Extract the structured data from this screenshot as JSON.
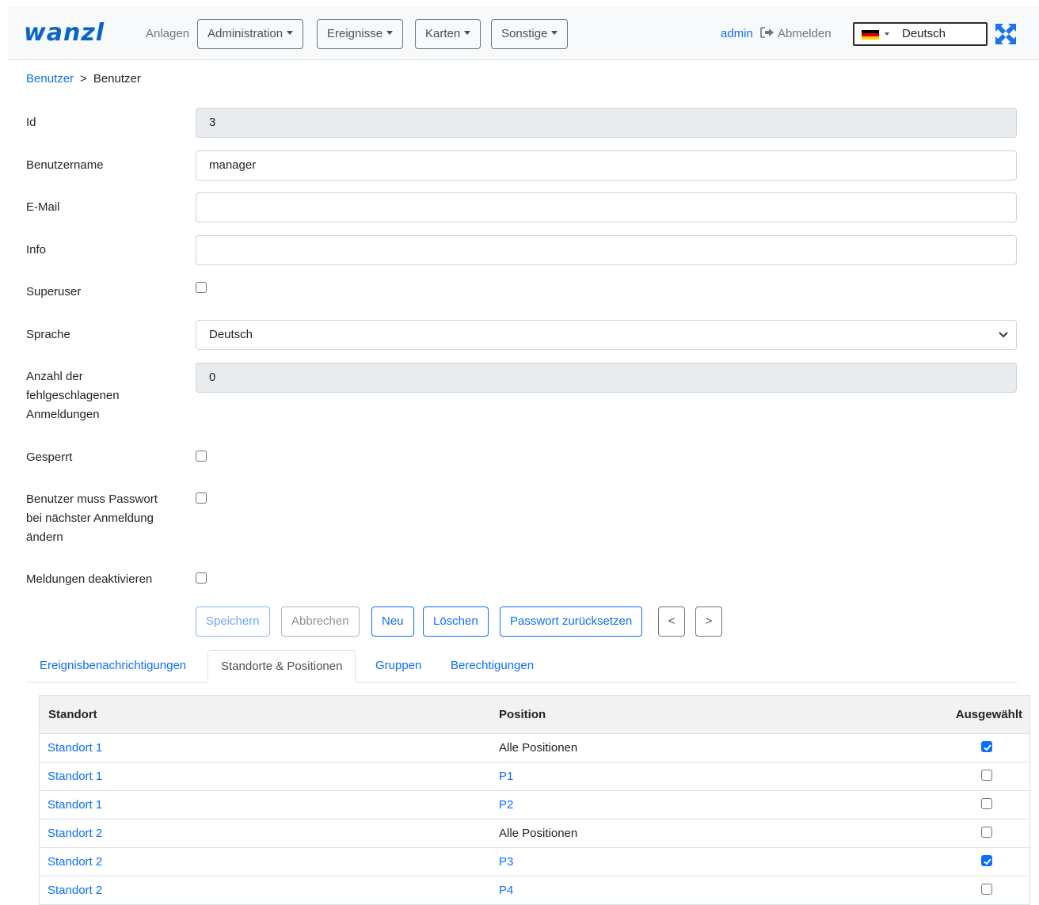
{
  "nav": {
    "logo": "wanzl",
    "plants": "Anlagen",
    "menus": [
      {
        "label": "Administration"
      },
      {
        "label": "Ereignisse"
      },
      {
        "label": "Karten"
      },
      {
        "label": "Sonstige"
      }
    ],
    "user": "admin",
    "logout": "Abmelden",
    "language": "Deutsch"
  },
  "breadcrumb": {
    "parent": "Benutzer",
    "separator": ">",
    "current": "Benutzer"
  },
  "form": {
    "id": {
      "label": "Id",
      "value": "3"
    },
    "username": {
      "label": "Benutzername",
      "value": "manager"
    },
    "email": {
      "label": "E-Mail",
      "value": ""
    },
    "info": {
      "label": "Info",
      "value": ""
    },
    "superuser": {
      "label": "Superuser",
      "checked": false
    },
    "language": {
      "label": "Sprache",
      "value": "Deutsch"
    },
    "failed_logins": {
      "label": "Anzahl der fehlgeschlagenen Anmeldungen",
      "value": "0"
    },
    "locked": {
      "label": "Gesperrt",
      "checked": false
    },
    "must_change_password": {
      "label": "Benutzer muss Passwort bei nächster Anmeldung ändern",
      "checked": false
    },
    "disable_messages": {
      "label": "Meldungen deaktivieren",
      "checked": false
    }
  },
  "actions": {
    "save": "Speichern",
    "cancel": "Abbrechen",
    "new": "Neu",
    "delete": "Löschen",
    "reset_password": "Passwort zurücksetzen",
    "prev": "<",
    "next": ">"
  },
  "tabs": [
    {
      "label": "Ereignisbenachrichtigungen",
      "active": false
    },
    {
      "label": "Standorte & Positionen",
      "active": true
    },
    {
      "label": "Gruppen",
      "active": false
    },
    {
      "label": "Berechtigungen",
      "active": false
    }
  ],
  "table": {
    "headers": [
      "Standort",
      "Position",
      "Ausgewählt"
    ],
    "rows": [
      {
        "location": "Standort 1",
        "position": "Alle Positionen",
        "position_link": false,
        "selected": true
      },
      {
        "location": "Standort 1",
        "position": "P1",
        "position_link": true,
        "selected": false
      },
      {
        "location": "Standort 1",
        "position": "P2",
        "position_link": true,
        "selected": false
      },
      {
        "location": "Standort 2",
        "position": "Alle Positionen",
        "position_link": false,
        "selected": false
      },
      {
        "location": "Standort 2",
        "position": "P3",
        "position_link": true,
        "selected": true
      },
      {
        "location": "Standort 2",
        "position": "P4",
        "position_link": true,
        "selected": false
      }
    ]
  },
  "colors": {
    "primary": "#0d6efd",
    "navbar_bg": "#f8f9fa",
    "logo": "#0a63c9",
    "readonly_bg": "#e9ecef"
  },
  "icons": {
    "logout": "sign-out-icon",
    "fullscreen": "expand-arrows-icon",
    "flag": "german-flag-icon"
  }
}
